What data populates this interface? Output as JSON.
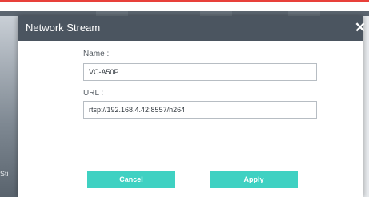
{
  "background": {
    "left_label": "Sti"
  },
  "dialog": {
    "title": "Network Stream",
    "close_glyph": "✕",
    "fields": {
      "name": {
        "label": "Name :",
        "value": "VC-A50P"
      },
      "url": {
        "label": "URL :",
        "value": "rtsp://192.168.4.42:8557/h264"
      }
    },
    "buttons": {
      "cancel": "Cancel",
      "apply": "Apply"
    }
  },
  "colors": {
    "accent": "#3fd1c2",
    "titlebar": "#4b5560",
    "top_line": "#e8403a"
  }
}
